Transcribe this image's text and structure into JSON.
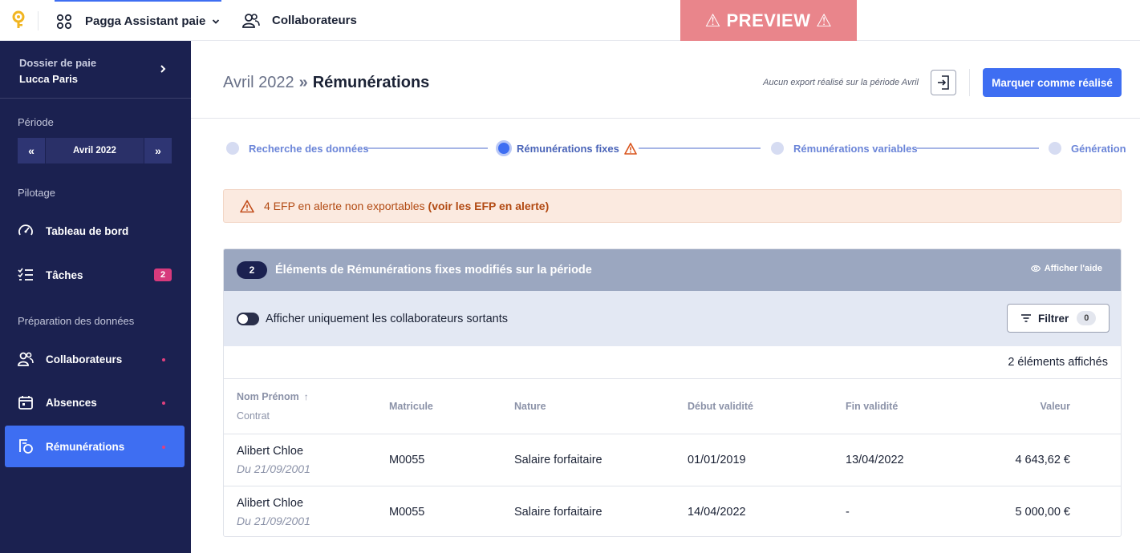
{
  "topbar": {
    "app_name": "Pagga Assistant paie",
    "collaborateurs": "Collaborateurs",
    "preview": "⚠ PREVIEW ⚠"
  },
  "sidebar": {
    "dossier_label": "Dossier de paie",
    "dossier_name": "Lucca Paris",
    "periode_title": "Période",
    "periode_value": "Avril 2022",
    "pilotage_title": "Pilotage",
    "tableau": "Tableau de bord",
    "taches": "Tâches",
    "taches_count": "2",
    "preparation_title": "Préparation des données",
    "collaborateurs": "Collaborateurs",
    "absences": "Absences",
    "remunerations": "Rémunérations"
  },
  "header": {
    "period": "Avril 2022",
    "separator": "»",
    "page": "Rémunérations",
    "export_note": "Aucun export réalisé sur la période Avril",
    "mark_done": "Marquer comme réalisé"
  },
  "stepper": {
    "s1": "Recherche des données",
    "s2": "Rémunérations fixes",
    "s3": "Rémunérations variables",
    "s4": "Génération"
  },
  "alert": {
    "text": "4 EFP en alerte non exportables",
    "link": "(voir les EFP en alerte)"
  },
  "panel": {
    "count": "2",
    "title": "Éléments de Rémunérations fixes modifiés sur la période",
    "help": "Afficher l'aide",
    "toggle_label": "Afficher uniquement les collaborateurs sortants",
    "filter": "Filtrer",
    "filter_count": "0",
    "displayed": "2 éléments affichés",
    "columns": {
      "name": "Nom Prénom",
      "contract": "Contrat",
      "matricule": "Matricule",
      "nature": "Nature",
      "debut": "Début validité",
      "fin": "Fin validité",
      "valeur": "Valeur"
    },
    "rows": [
      {
        "name": "Alibert Chloe",
        "contract": "Du 21/09/2001",
        "matricule": "M0055",
        "nature": "Salaire forfaitaire",
        "debut": "01/01/2019",
        "fin": "13/04/2022",
        "valeur": "4 643,62 €"
      },
      {
        "name": "Alibert Chloe",
        "contract": "Du 21/09/2001",
        "matricule": "M0055",
        "nature": "Salaire forfaitaire",
        "debut": "14/04/2022",
        "fin": "-",
        "valeur": "5 000,00 €"
      }
    ]
  },
  "colors": {
    "accent": "#3e6ef2",
    "sidebar": "#1b2150",
    "preview": "#e9858b",
    "alert_text": "#b24a13"
  }
}
